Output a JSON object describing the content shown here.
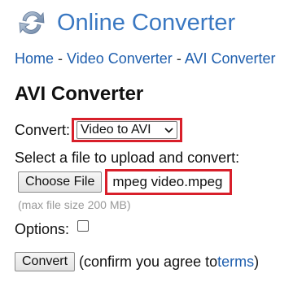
{
  "header": {
    "logo_icon": "refresh-arrows-icon",
    "title": "Online Converter",
    "color": "#3a78c2"
  },
  "breadcrumb": {
    "home": "Home",
    "sep": "-",
    "video_converter": "Video Converter",
    "avi_converter": "AVI Converter",
    "link_color": "#1f5fae"
  },
  "page": {
    "title": "AVI Converter"
  },
  "convert": {
    "label": "Convert:",
    "selected": "Video to AVI",
    "chevron_icon": "chevron-down-icon"
  },
  "upload": {
    "label": "Select a file to upload and convert:",
    "button_label": "Choose File",
    "file_name": "mpeg video.mpeg",
    "max_size": "(max file size 200 MB)"
  },
  "options": {
    "label": "Options:"
  },
  "submit": {
    "button_label": "Convert",
    "confirm_text_before": "(confirm you agree to ",
    "terms_link": "terms",
    "confirm_text_after": ")"
  },
  "highlight_color": "#d81f2a"
}
